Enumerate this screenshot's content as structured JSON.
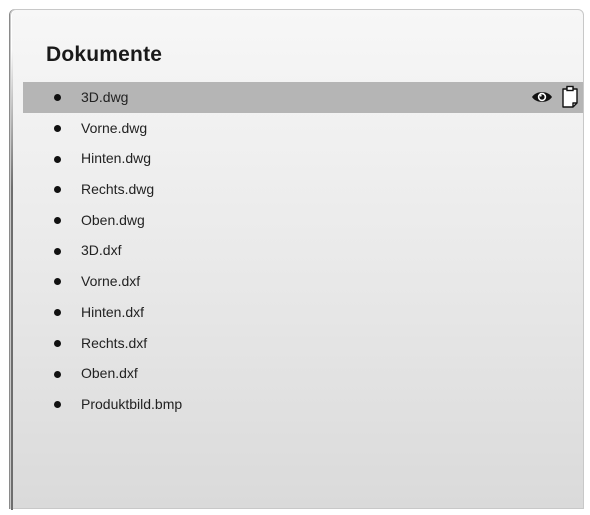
{
  "panel": {
    "title": "Dokumente"
  },
  "documents": [
    {
      "name": "3D.dwg",
      "selected": true
    },
    {
      "name": "Vorne.dwg"
    },
    {
      "name": "Hinten.dwg"
    },
    {
      "name": "Rechts.dwg"
    },
    {
      "name": "Oben.dwg"
    },
    {
      "name": "3D.dxf"
    },
    {
      "name": "Vorne.dxf"
    },
    {
      "name": "Hinten.dxf"
    },
    {
      "name": "Rechts.dxf"
    },
    {
      "name": "Oben.dxf"
    },
    {
      "name": "Produktbild.bmp"
    }
  ],
  "row_actions": [
    {
      "icon": "eye-icon"
    },
    {
      "icon": "clipboard-icon"
    }
  ],
  "colors": {
    "selected_row": "#b5b5b5",
    "text": "#222222",
    "bullet": "#111111"
  }
}
